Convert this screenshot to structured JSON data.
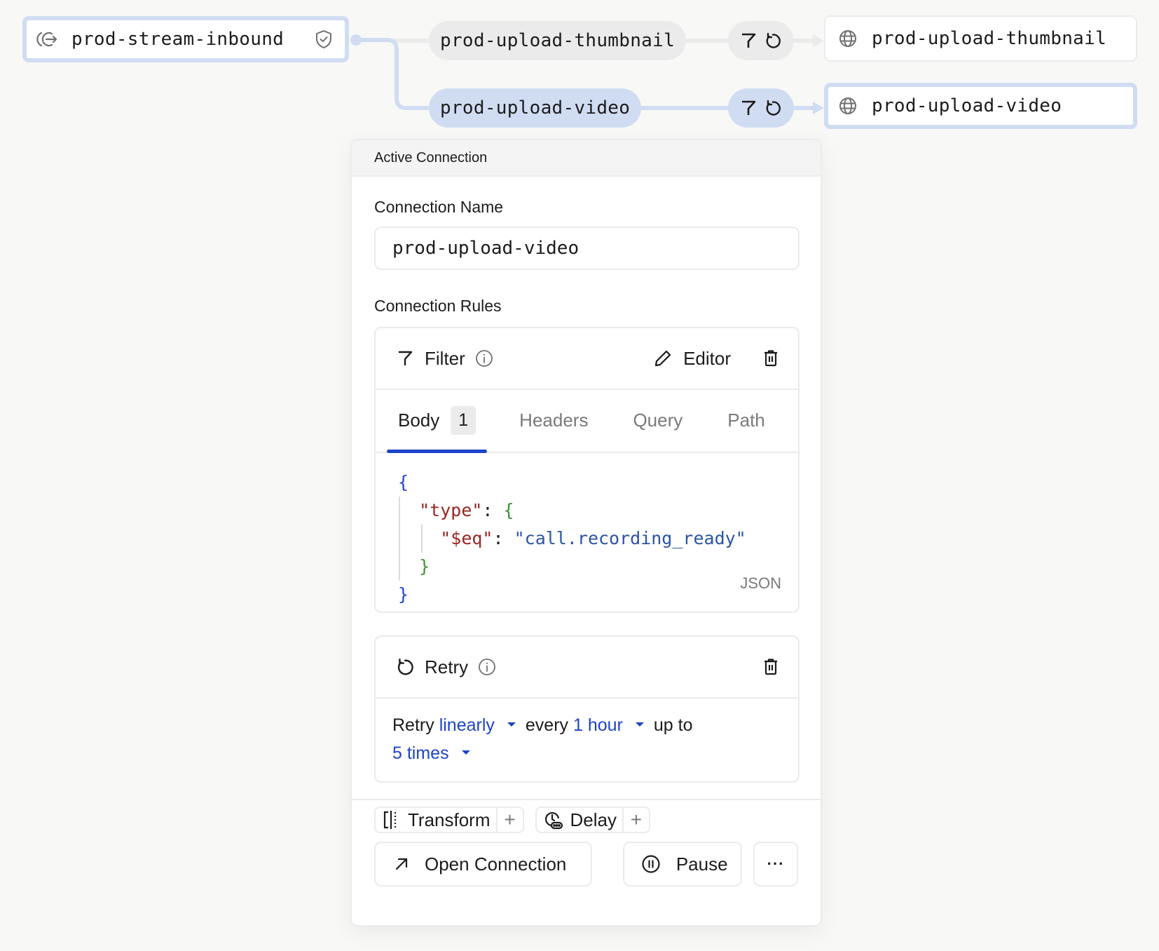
{
  "canvas": {
    "source": {
      "name": "prod-stream-inbound",
      "icon": "source-inbound-icon",
      "badge_icon": "shield-check-icon"
    },
    "connections": [
      {
        "name": "prod-upload-thumbnail",
        "rule_icons": [
          "filter-icon",
          "retry-icon"
        ],
        "destination": "prod-upload-thumbnail",
        "destination_icon": "globe-icon",
        "selected": false
      },
      {
        "name": "prod-upload-video",
        "rule_icons": [
          "filter-icon",
          "retry-icon"
        ],
        "destination": "prod-upload-video",
        "destination_icon": "globe-icon",
        "selected": true
      }
    ],
    "colors": {
      "selected_line": "#d0dcf2",
      "idle_line": "#ebebeb",
      "background": "#f8f8f7"
    }
  },
  "panel": {
    "header": "Active Connection",
    "connection_name_label": "Connection Name",
    "connection_name_value": "prod-upload-video",
    "connection_rules_label": "Connection Rules",
    "filter": {
      "title": "Filter",
      "editor_label": "Editor",
      "tabs": [
        {
          "label": "Body",
          "badge": "1",
          "active": true
        },
        {
          "label": "Headers",
          "active": false
        },
        {
          "label": "Query",
          "active": false
        },
        {
          "label": "Path",
          "active": false
        }
      ],
      "code": {
        "language": "JSON",
        "key_outer": "\"type\"",
        "key_inner": "\"$eq\"",
        "value": "\"call.recording_ready\"",
        "open_brace": "{",
        "close_brace": "}",
        "colon": ": "
      }
    },
    "retry": {
      "title": "Retry",
      "sentence_prefix": "Retry",
      "strategy": "linearly",
      "every_label": "every",
      "interval": "1 hour",
      "up_to_label": "up to",
      "count": "5 times"
    },
    "addons": [
      {
        "label": "Transform",
        "icon": "transform-icon"
      },
      {
        "label": "Delay",
        "icon": "delay-icon"
      }
    ],
    "footer": {
      "open_label": "Open Connection",
      "pause_label": "Pause",
      "more_label": "···"
    },
    "accent_color": "#1e44c8"
  }
}
